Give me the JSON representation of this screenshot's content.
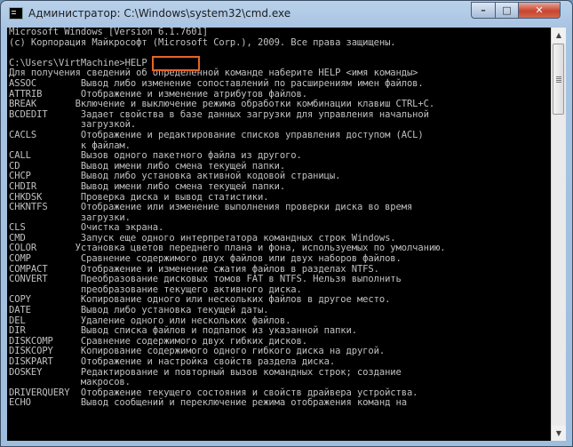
{
  "window": {
    "title": "Администратор: C:\\Windows\\system32\\cmd.exe",
    "controls": {
      "minimize": "–",
      "maximize": "□",
      "close": "✕"
    }
  },
  "console": {
    "lines": [
      "Microsoft Windows [Version 6.1.7601]",
      "(c) Корпорация Майкрософт (Microsoft Corp.), 2009. Все права защищены.",
      "",
      "C:\\Users\\VirtMachine>HELP",
      "Для получения сведений об определенной команде наберите HELP <имя команды>",
      "ASSOC        Вывод либо изменение сопоставлений по расширениям имен файлов.",
      "ATTRIB       Отображение и изменение атрибутов файлов.",
      "BREAK       Включение и выключение режима обработки комбинации клавиш CTRL+C.",
      "BCDEDIT      Задает свойства в базе данных загрузки для управления начальной",
      "             загрузкой.",
      "CACLS        Отображение и редактирование списков управления доступом (ACL)",
      "             к файлам.",
      "CALL         Вызов одного пакетного файла из другого.",
      "CD           Вывод имени либо смена текущей папки.",
      "CHCP         Вывод либо установка активной кодовой страницы.",
      "CHDIR        Вывод имени либо смена текущей папки.",
      "CHKDSK       Проверка диска и вывод статистики.",
      "CHKNTFS      Отображение или изменение выполнения проверки диска во время",
      "             загрузки.",
      "CLS          Очистка экрана.",
      "CMD          Запуск еще одного интерпретатора командных строк Windows.",
      "COLOR       Установка цветов переднего плана и фона, используемых по умолчанию.",
      "COMP         Сравнение содержимого двух файлов или двух наборов файлов.",
      "COMPACT      Отображение и изменение сжатия файлов в разделах NTFS.",
      "CONVERT      Преобразование дисковых томов FAT в NTFS. Нельзя выполнить",
      "             преобразование текущего активного диска.",
      "COPY         Копирование одного или нескольких файлов в другое место.",
      "DATE         Вывод либо установка текущей даты.",
      "DEL          Удаление одного или нескольких файлов.",
      "DIR          Вывод списка файлов и подпапок из указанной папки.",
      "DISKCOMP     Сравнение содержимого двух гибких дисков.",
      "DISKCOPY     Копирование содержимого одного гибкого диска на другой.",
      "DISKPART     Отображение и настройка свойств раздела диска.",
      "DOSKEY       Редактирование и повторный вызов командных строк; создание",
      "             макросов.",
      "DRIVERQUERY  Отображение текущего состояния и свойств драйвера устройства.",
      "ECHO         Вывод сообщений и переключение режима отображения команд на"
    ]
  },
  "annotation": {
    "highlighted_text": "HELP",
    "color": "#e8622a"
  },
  "colors": {
    "console_bg": "#000000",
    "console_fg": "#c0c0c0",
    "frame": "#a9c4e2"
  }
}
